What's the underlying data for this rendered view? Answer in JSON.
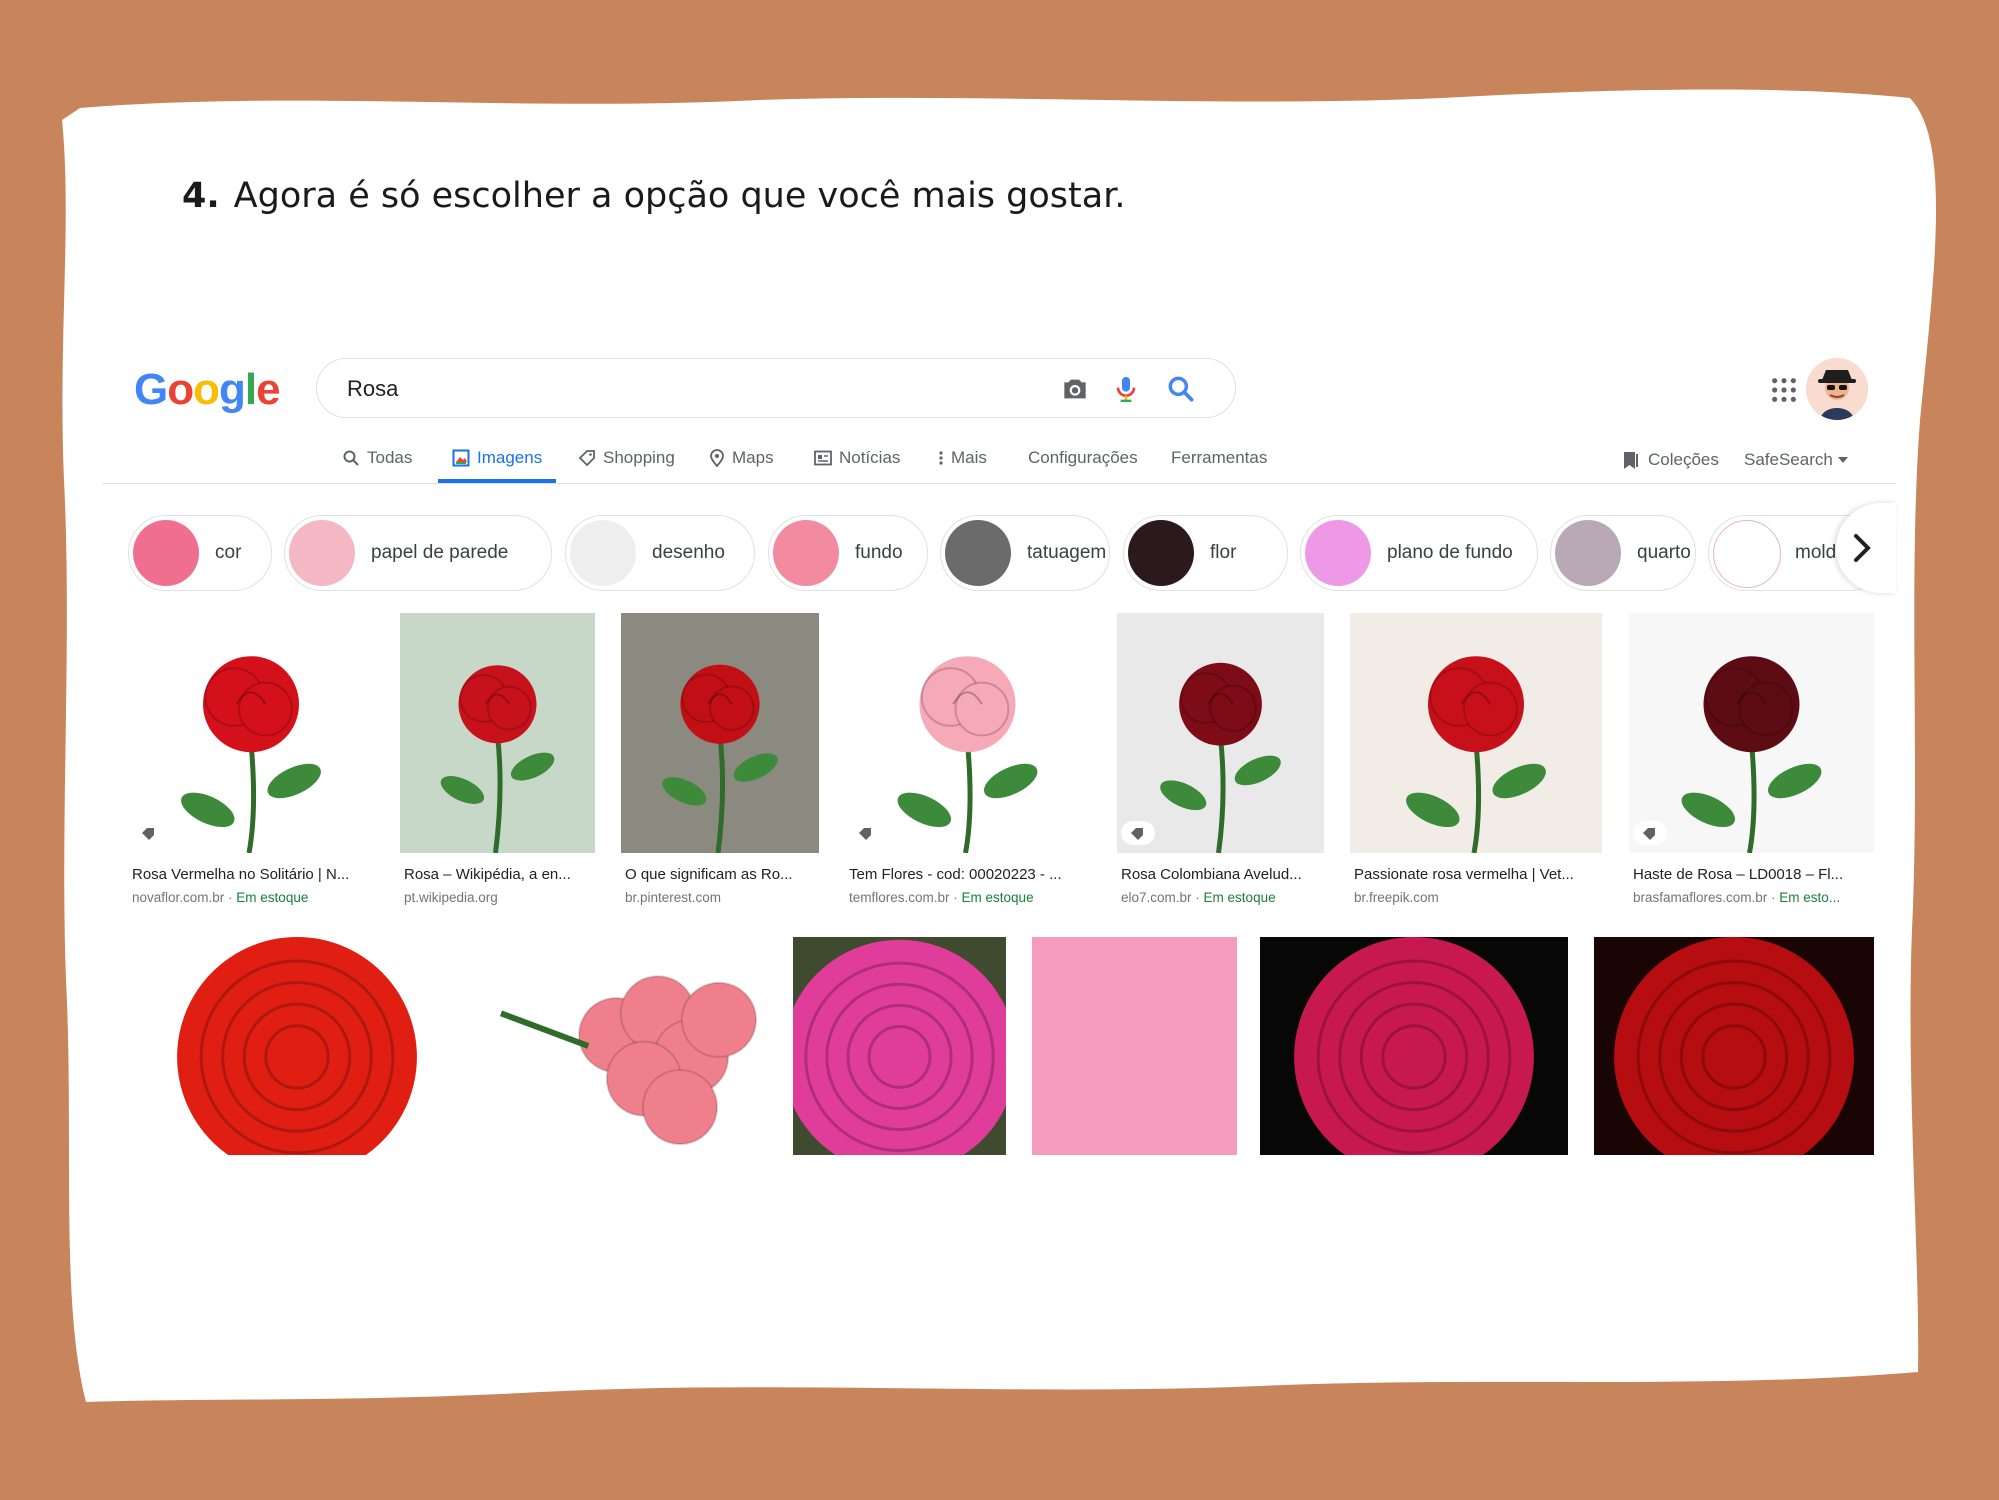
{
  "instruction": {
    "number": "4.",
    "text": "Agora é só escolher a opção que você mais gostar."
  },
  "header": {
    "logo_letters": [
      "G",
      "o",
      "o",
      "g",
      "l",
      "e"
    ],
    "logo_colors": [
      "#4285F4",
      "#EA4335",
      "#FBBC05",
      "#4285F4",
      "#34A853",
      "#EA4335"
    ],
    "search_value": "Rosa"
  },
  "tabs": [
    {
      "label": "Todas",
      "icon": "search-icon"
    },
    {
      "label": "Imagens",
      "icon": "image-icon",
      "active": true
    },
    {
      "label": "Shopping",
      "icon": "tag-icon"
    },
    {
      "label": "Maps",
      "icon": "map-pin-icon"
    },
    {
      "label": "Notícias",
      "icon": "news-icon"
    },
    {
      "label": "Mais",
      "icon": "more-dots-icon"
    },
    {
      "label": "Configurações"
    },
    {
      "label": "Ferramentas"
    }
  ],
  "right_tools": {
    "collections": "Coleções",
    "safesearch": "SafeSearch"
  },
  "chips": [
    {
      "label": "cor",
      "color": "#f06f8e"
    },
    {
      "label": "papel de parede",
      "color": "#f4b8c4"
    },
    {
      "label": "desenho",
      "color": "#eeeeee"
    },
    {
      "label": "fundo",
      "color": "#f28aa0"
    },
    {
      "label": "tatuagem",
      "color": "#6b6b6b"
    },
    {
      "label": "flor",
      "color": "#2a1a1c"
    },
    {
      "label": "plano de fundo",
      "color": "#ee99e6"
    },
    {
      "label": "quarto",
      "color": "#b9a9b6"
    },
    {
      "label": "moldura",
      "color": "#ffffff"
    }
  ],
  "results_row1": [
    {
      "title": "Rosa Vermelha no Solitário | N...",
      "source": "novaflor.com.br",
      "stock": "Em estoque",
      "bg": "#ffffff",
      "flower": "#d4101b"
    },
    {
      "title": "Rosa – Wikipédia, a en...",
      "source": "pt.wikipedia.org",
      "stock": "",
      "bg": "#c8d8c8",
      "flower": "#c8121b"
    },
    {
      "title": "O que significam as Ro...",
      "source": "br.pinterest.com",
      "stock": "",
      "bg": "#8a8a80",
      "flower": "#c20f16"
    },
    {
      "title": "Tem Flores - cod: 00020223 - ...",
      "source": "temflores.com.br",
      "stock": "Em estoque",
      "bg": "#ffffff",
      "flower": "#f6a9b6"
    },
    {
      "title": "Rosa Colombiana Avelud...",
      "source": "elo7.com.br",
      "stock": "Em estoque",
      "bg": "#e9e9e9",
      "flower": "#7d0c16"
    },
    {
      "title": "Passionate rosa vermelha | Vet...",
      "source": "br.freepik.com",
      "stock": "",
      "bg": "#f1ece6",
      "flower": "#c8101a"
    },
    {
      "title": "Haste de Rosa – LD0018 – Fl...",
      "source": "brasfamaflores.com.br",
      "stock": "Em esto...",
      "bg": "#f7f7f7",
      "flower": "#5e0c14"
    }
  ],
  "results_row2": [
    {
      "bg": "#ffffff",
      "flower": "#e01f12"
    },
    {
      "bg": "#ffffff",
      "flower": "#f07f8c"
    },
    {
      "bg": "#3f4a2f",
      "flower": "#e03c9a"
    },
    {
      "bg": "#f59bbd",
      "flower": "#f59bbd"
    },
    {
      "bg": "#070707",
      "flower": "#c81850"
    },
    {
      "bg": "#1a0505",
      "flower": "#b50d10"
    }
  ]
}
